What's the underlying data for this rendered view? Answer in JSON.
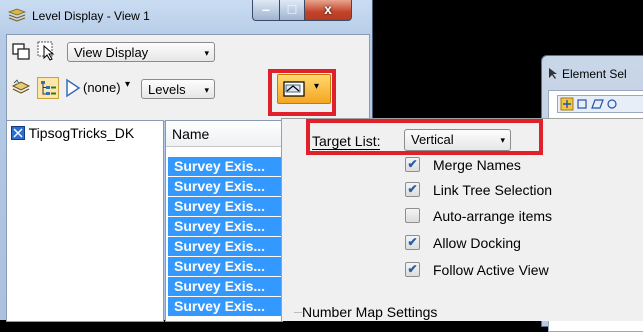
{
  "window": {
    "title": "Level Display - View 1",
    "minimize_glyph": "–",
    "maximize_glyph": "□",
    "close_glyph": "x"
  },
  "toolbar": {
    "display_mode": "View Display",
    "filter_value": "(none)",
    "levels_label": "Levels",
    "dropdown_glyph": "▾"
  },
  "tree": {
    "root_label": "TipsogTricks_DK"
  },
  "list": {
    "header": "Name",
    "rows": [
      "Survey Exis...",
      "Survey Exis...",
      "Survey Exis...",
      "Survey Exis...",
      "Survey Exis...",
      "Survey Exis...",
      "Survey Exis...",
      "Survey Exis..."
    ]
  },
  "popup": {
    "target_list_label": "Target List:",
    "target_list_value": "Vertical",
    "options": [
      {
        "label": "Merge Names",
        "checked": true
      },
      {
        "label": "Link Tree Selection",
        "checked": true
      },
      {
        "label": "Auto-arrange items",
        "checked": false
      },
      {
        "label": "Allow Docking",
        "checked": true
      },
      {
        "label": "Follow Active View",
        "checked": true
      }
    ],
    "section_title": "Number Map Settings"
  },
  "element_selection": {
    "title": "Element Sel"
  },
  "colors": {
    "highlight_red": "#e0202a",
    "selection_blue": "#3399ff",
    "window_frame": "#b5cbe6"
  }
}
